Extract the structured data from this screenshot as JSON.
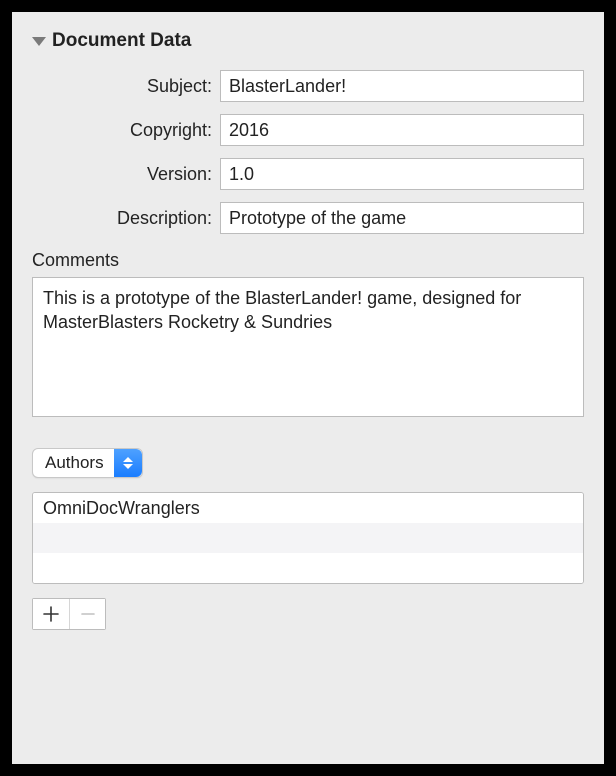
{
  "section": {
    "title": "Document Data"
  },
  "fields": {
    "subject": {
      "label": "Subject:",
      "value": "BlasterLander!"
    },
    "copyright": {
      "label": "Copyright:",
      "value": "2016"
    },
    "version": {
      "label": "Version:",
      "value": "1.0"
    },
    "description": {
      "label": "Description:",
      "value": "Prototype of the game"
    }
  },
  "comments": {
    "label": "Comments",
    "value": "This is a prototype of the BlasterLander! game, designed for MasterBlasters Rocketry & Sundries"
  },
  "dropdown": {
    "selected": "Authors"
  },
  "list": {
    "items": [
      "OmniDocWranglers",
      "",
      ""
    ]
  },
  "buttons": {
    "add": "+",
    "remove": "−"
  }
}
